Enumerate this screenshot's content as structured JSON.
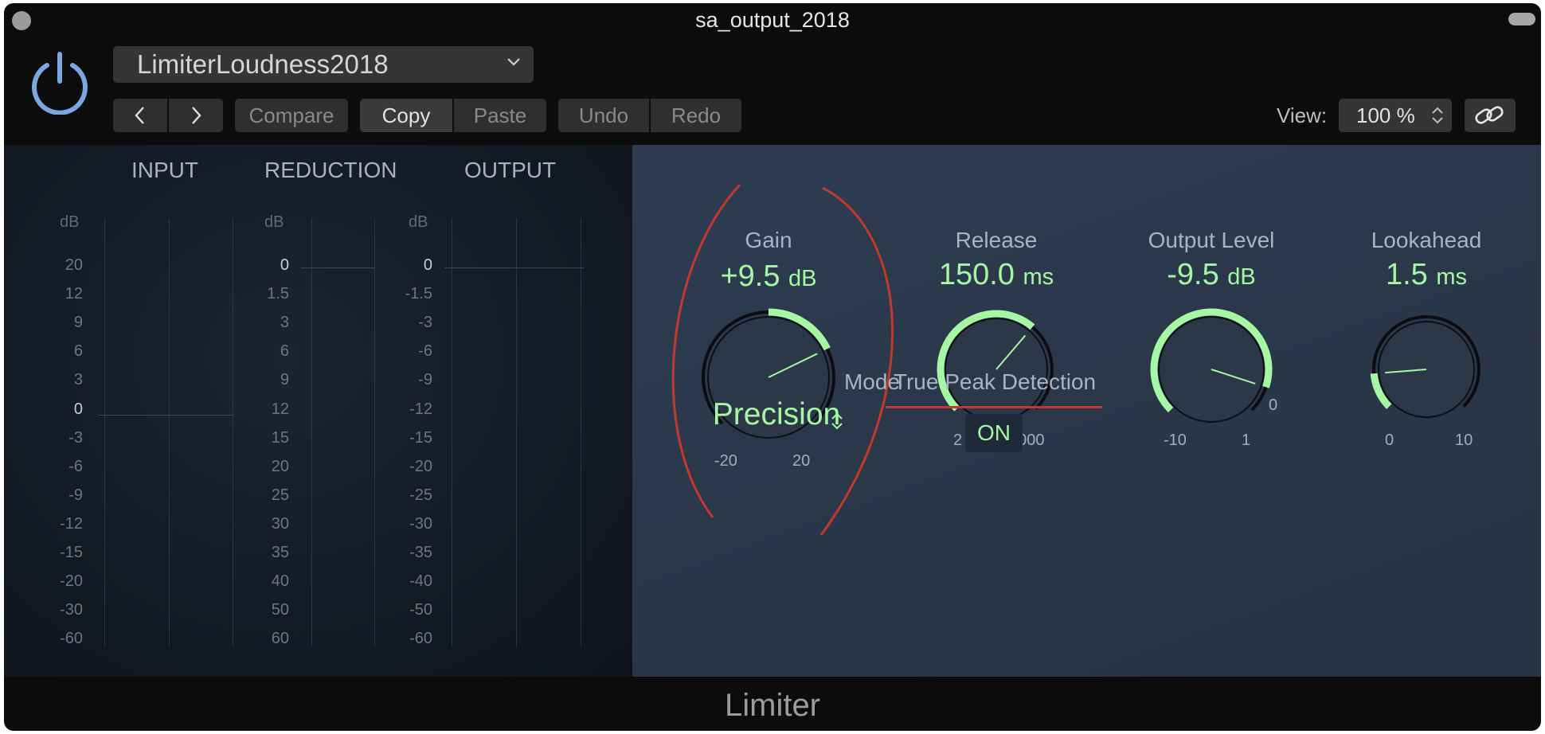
{
  "window": {
    "title": "sa_output_2018"
  },
  "header": {
    "preset": "LimiterLoudness2018",
    "buttons": {
      "compare": "Compare",
      "copy": "Copy",
      "paste": "Paste",
      "undo": "Undo",
      "redo": "Redo"
    },
    "view_label": "View:",
    "view_value": "100 %"
  },
  "meters": {
    "input": {
      "title": "INPUT",
      "unit": "dB",
      "ticks": [
        "20",
        "12",
        "9",
        "6",
        "3",
        "0",
        "-3",
        "-6",
        "-9",
        "-12",
        "-15",
        "-20",
        "-30",
        "-60"
      ]
    },
    "reduction": {
      "title": "REDUCTION",
      "unit": "dB",
      "ticks": [
        "0",
        "1.5",
        "3",
        "6",
        "9",
        "12",
        "15",
        "20",
        "25",
        "30",
        "35",
        "40",
        "50",
        "60"
      ]
    },
    "output": {
      "title": "OUTPUT",
      "unit": "dB",
      "ticks": [
        "0",
        "-1.5",
        "-3",
        "-6",
        "-9",
        "-12",
        "-15",
        "-20",
        "-25",
        "-30",
        "-35",
        "-40",
        "-50",
        "-60"
      ]
    }
  },
  "controls": {
    "gain": {
      "label": "Gain",
      "value": "+9.5",
      "unit": "dB",
      "min_label": "-20",
      "max_label": "20",
      "min": -20,
      "max": 20,
      "current": 9.5
    },
    "release": {
      "label": "Release",
      "value": "150.0",
      "unit": "ms",
      "min_label": "2",
      "max_label": "2000",
      "fraction": 0.65
    },
    "output_level": {
      "label": "Output Level",
      "value": "-9.5",
      "unit": "dB",
      "min_label": "-10",
      "max_label": "1",
      "mid_label": "0",
      "fraction": 0.9
    },
    "lookahead": {
      "label": "Lookahead",
      "value": "1.5",
      "unit": "ms",
      "min_label": "0",
      "max_label": "10",
      "fraction": 0.15
    },
    "mode": {
      "label": "Mode",
      "value": "Precision"
    },
    "true_peak": {
      "label": "True Peak Detection",
      "state": "ON"
    }
  },
  "footer": {
    "title": "Limiter"
  },
  "colors": {
    "accent_green": "#a6f7a4",
    "highlight_red": "#c2382a",
    "power_blue": "#7aa7df"
  }
}
